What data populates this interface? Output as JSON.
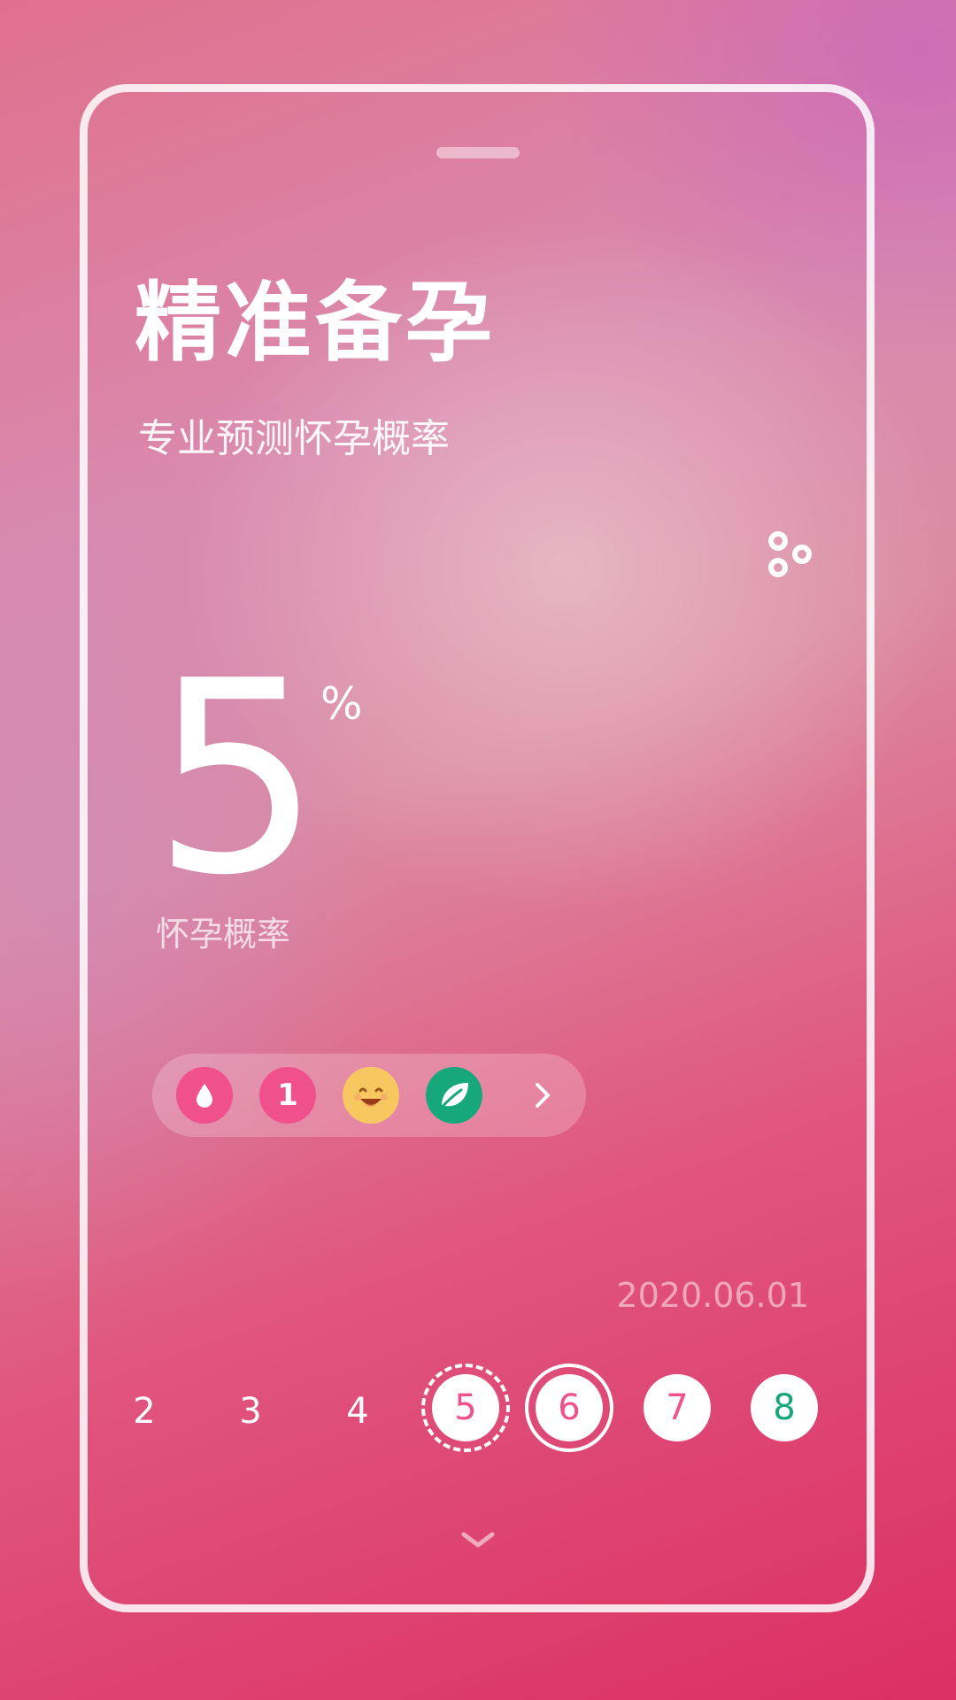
{
  "header": {
    "title": "精准备孕",
    "subtitle": "专业预测怀孕概率"
  },
  "probability": {
    "value": "5",
    "unit": "%",
    "label": "怀孕概率"
  },
  "status_bar": {
    "items": [
      {
        "icon": "drop-icon",
        "color": "#f0508c"
      },
      {
        "icon": "number-badge",
        "text": "1",
        "color": "#f0508c"
      },
      {
        "icon": "smile-face-icon",
        "color": "#f7c860"
      },
      {
        "icon": "leaf-icon",
        "color": "#16a87a"
      }
    ],
    "arrow_icon": "chevron-right-icon"
  },
  "calendar": {
    "date": "2020.06.01",
    "days": [
      "2",
      "3",
      "4",
      "5",
      "6",
      "7",
      "8"
    ]
  },
  "colors": {
    "accent_pink": "#f0508c",
    "accent_green": "#16a87a",
    "accent_yellow": "#f7c860"
  },
  "icons": {
    "top_right": "more-dots-icon",
    "bottom": "chevron-down-icon"
  }
}
